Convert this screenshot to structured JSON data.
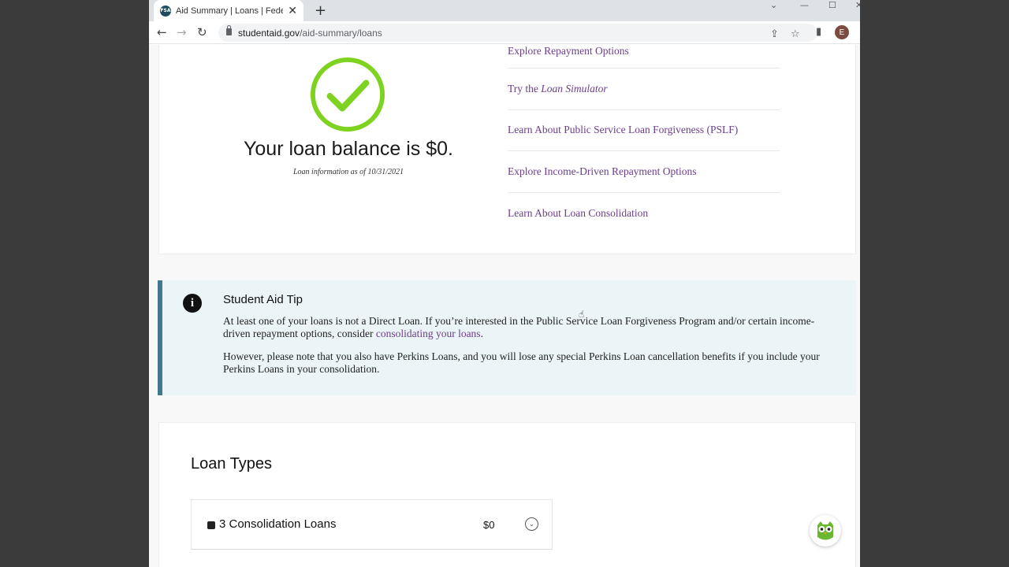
{
  "browser": {
    "tab_title": "Aid Summary | Loans | Federal St",
    "favicon_text": "FSA",
    "url_host": "studentaid.gov",
    "url_path": "/aid-summary/loans",
    "avatar_letter": "E"
  },
  "summary": {
    "balance_text": "Your loan balance is $0.",
    "as_of_text": "Loan information as of 10/31/2021",
    "check_color": "#7ed321"
  },
  "links": {
    "explore_repayment": "Explore Repayment Options",
    "loan_sim_prefix": "Try the ",
    "loan_sim_em": "Loan Simulator",
    "pslf": "Learn About Public Service Loan Forgiveness (PSLF)",
    "idr": "Explore Income-Driven Repayment Options",
    "consolidation": "Learn About Loan Consolidation"
  },
  "tip": {
    "title": "Student Aid Tip",
    "p1_before": "At least one of your loans is not a Direct Loan. If you’re interested in the Public Service Loan Forgiveness Program and/or certain income-driven repayment options, consider ",
    "p1_link": "consolidating your loans",
    "p1_after": ".",
    "p2": "However, please note that you also have Perkins Loans, and you will lose any special Perkins Loan cancellation benefits if you include your Perkins Loans in your consolidation."
  },
  "loans": {
    "section_title": "Loan Types",
    "rows": [
      {
        "name": "3 Consolidation Loans",
        "amount": "$0"
      }
    ]
  },
  "colors": {
    "link_purple": "#6b3e8a",
    "tip_border": "#3e7a8c",
    "tip_bg": "#ebf4f6"
  }
}
